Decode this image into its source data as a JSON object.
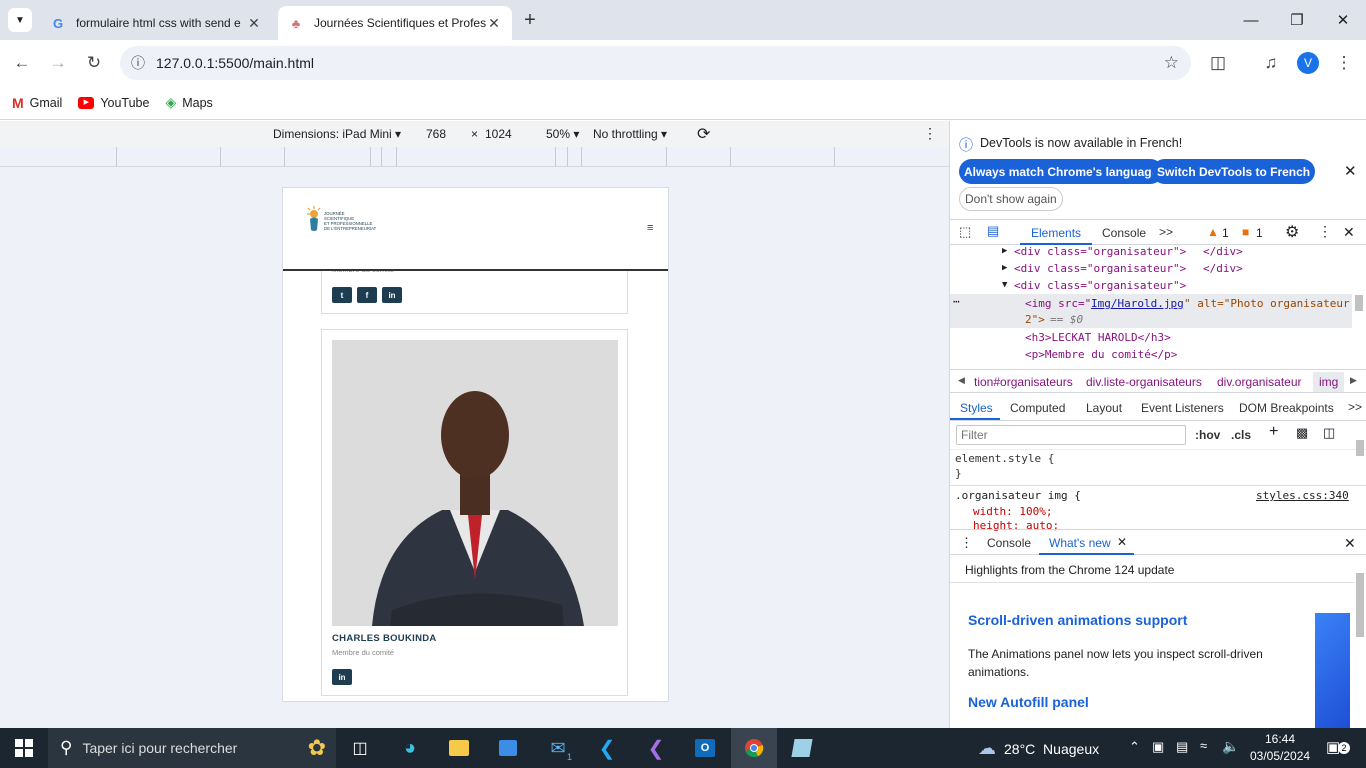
{
  "tabs": [
    {
      "title": "formulaire html css with send e",
      "favicon": "G"
    },
    {
      "title": "Journées Scientifiques et Profes",
      "favicon": "♣"
    }
  ],
  "new_tab": "+",
  "window": {
    "minimize": "—",
    "restore": "❐",
    "close": "✕"
  },
  "url": "127.0.0.1:5500/main.html",
  "bookmarks": [
    {
      "label": "Gmail"
    },
    {
      "label": "YouTube"
    },
    {
      "label": "Maps"
    }
  ],
  "profile_initial": "V",
  "device_toolbar": {
    "dimensions": "Dimensions: iPad Mini ▾",
    "width": "768",
    "times": "×",
    "height": "1024",
    "zoom": "50% ▾",
    "throttling": "No throttling ▾",
    "menu": "⋮"
  },
  "site": {
    "logo_lines": [
      "JOURNÉE",
      "SCIENTIFIQUE",
      "ET PROFESSIONNELLE",
      "DE L'ENTREPRENEURIAT"
    ],
    "menu_icon": "≡",
    "card1_role": "Membre du comité",
    "card1_social": [
      "t",
      "f",
      "in"
    ],
    "name": "CHARLES BOUKINDA",
    "role": "Membre du comité",
    "card2_social": [
      "in"
    ]
  },
  "devtools": {
    "notice": "DevTools is now available in French!",
    "btn_match": "Always match Chrome's language",
    "btn_switch": "Switch DevTools to French",
    "btn_dont": "Don't show again",
    "tabs": [
      "Elements",
      "Console"
    ],
    "more": ">>",
    "warn_count": "1",
    "err_count": "1",
    "dom": {
      "line1": "<div class=\"organisateur\">",
      "line1_end": "</div>",
      "line2": "<div class=\"organisateur\">",
      "line2_end": "</div>",
      "line3": "<div class=\"organisateur\">",
      "img_open": "<img src=\"",
      "img_src": "Img/Harold.jpg",
      "img_alt": "\" alt=\"Photo organisateur",
      "img_alt2": "2\">",
      "eq": "== $0",
      "h3": "<h3>LECKAT HAROLD</h3>",
      "p": "<p>Membre du comité</p>"
    },
    "breadcrumbs": [
      "tion#organisateurs",
      "div.liste-organisateurs",
      "div.organisateur",
      "img"
    ],
    "style_tabs": [
      "Styles",
      "Computed",
      "Layout",
      "Event Listeners",
      "DOM Breakpoints"
    ],
    "filter_placeholder": "Filter",
    "hov": ":hov",
    "cls": ".cls",
    "styles": {
      "el": "element.style {",
      "close": "}",
      "sel": ".organisateur img {",
      "src": "styles.css:340",
      "p1": "width: 100%;",
      "p2": "height: auto;"
    },
    "drawer_tabs": [
      "Console",
      "What's new"
    ],
    "highlights": "Highlights from the Chrome 124 update",
    "h_scroll": "Scroll-driven animations support",
    "scroll_desc": "The Animations panel now lets you inspect scroll-driven animations.",
    "h_autofill": "New Autofill panel"
  },
  "taskbar": {
    "search": "Taper ici pour rechercher",
    "weather": "28°C  Nuageux",
    "time": "16:44",
    "date": "03/05/2024",
    "notif": "2",
    "mail_badge": "1"
  }
}
